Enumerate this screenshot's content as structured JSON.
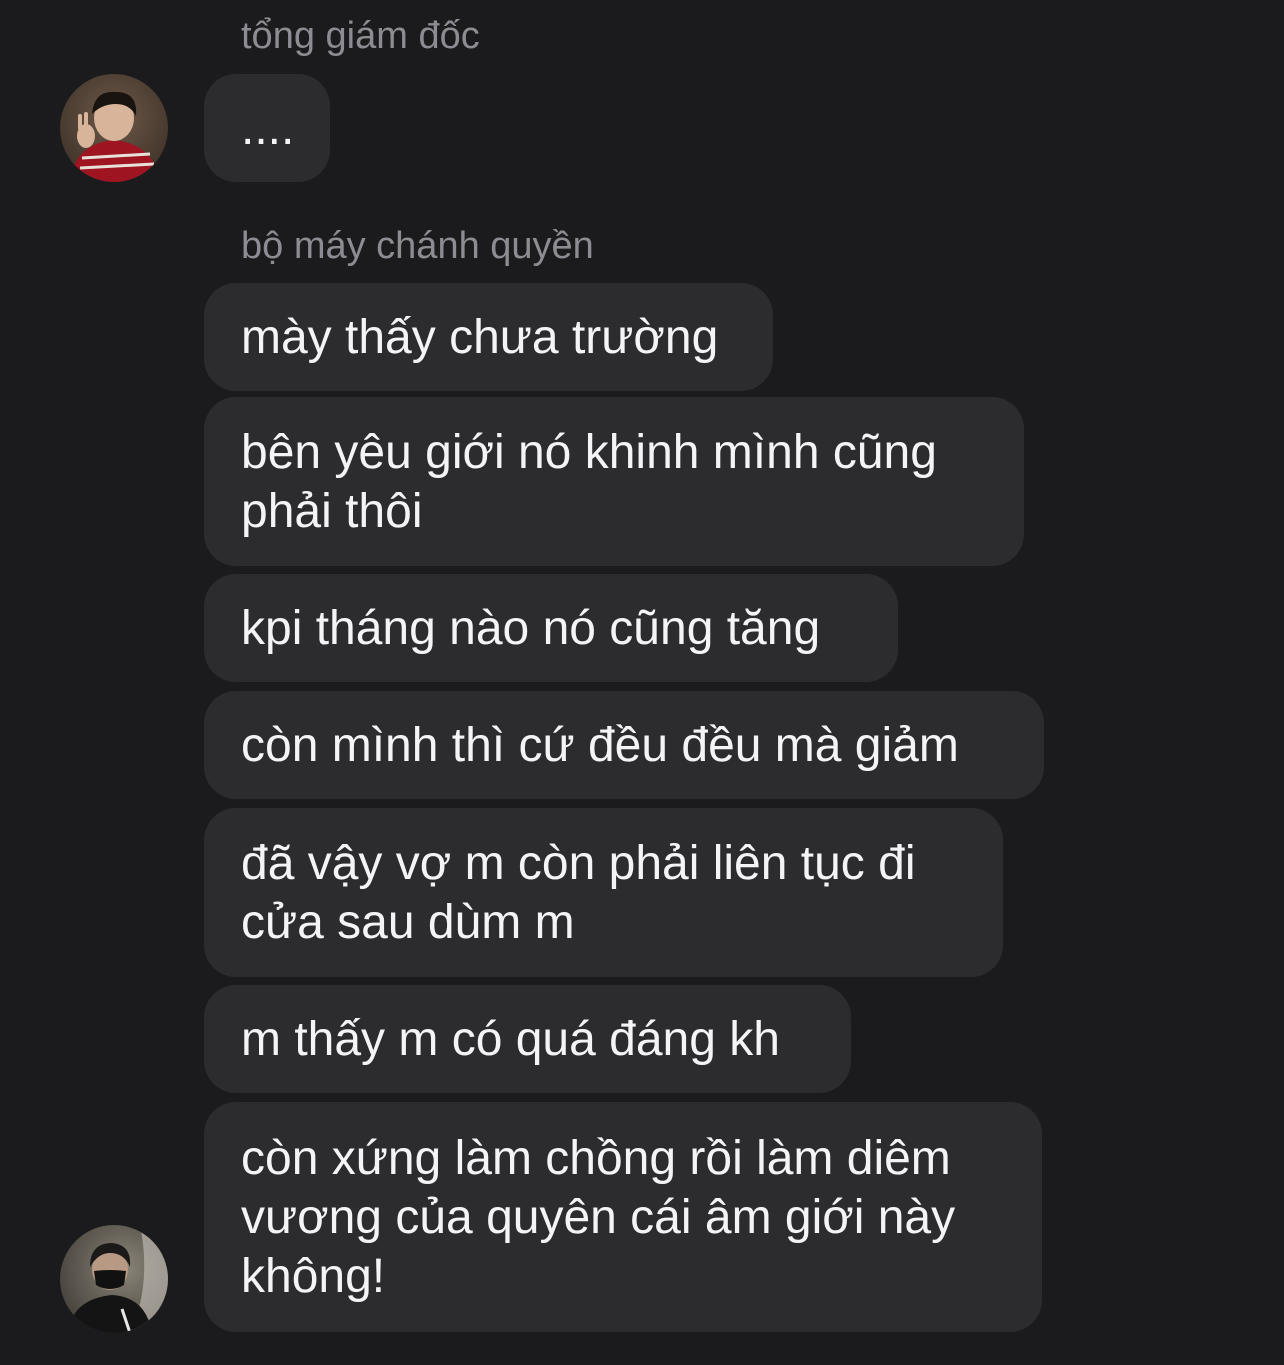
{
  "chat": {
    "groups": [
      {
        "sender": "tổng giám đốc",
        "avatar_icon": "user-avatar-red-jersey",
        "messages": [
          "...."
        ]
      },
      {
        "sender": "bộ máy chánh quyền",
        "avatar_icon": "user-avatar-black-mask",
        "messages": [
          "mày thấy chưa trường",
          "bên yêu giới nó khinh mình cũng\nphải thôi",
          "kpi tháng nào nó cũng tăng",
          "còn mình thì cứ đều đều mà giảm",
          "đã vậy vợ m còn phải liên tục đi\ncửa sau dùm m",
          "m thấy m có quá đáng kh",
          "còn xứng làm chồng rồi làm diêm\nvương của quyên cái âm giới này\nkhông!"
        ]
      }
    ]
  },
  "theme": {
    "background": "#1b1b1d",
    "bubble": "#2c2c2f",
    "text": "#f4f4f6",
    "sender_name": "#8c8c92"
  }
}
